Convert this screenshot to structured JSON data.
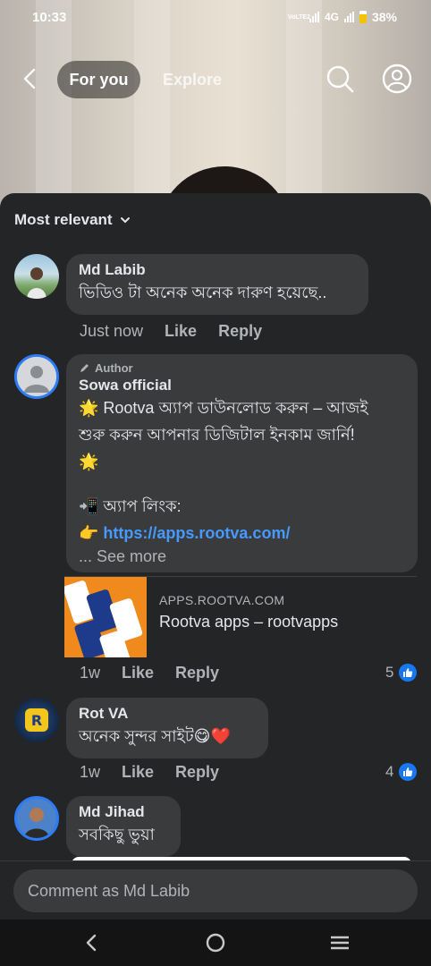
{
  "status": {
    "time": "10:33",
    "network": "4G",
    "battery": "38%",
    "volte": "VoLTE2"
  },
  "topnav": {
    "tab_for_you": "For you",
    "tab_explore": "Explore"
  },
  "sheet": {
    "sort_label": "Most relevant"
  },
  "comments": [
    {
      "name": "Md Labib",
      "lines": [
        "ভিডিও টা অনেক অনেক দারুণ হয়েছে.."
      ],
      "time": "Just now",
      "like": "Like",
      "reply": "Reply"
    },
    {
      "author_tag": "Author",
      "name": "Sowa official",
      "lines": [
        "🌟 Rootva অ্যাপ ডাউনলোড করুন – আজই",
        "শুরু করুন আপনার ডিজিটাল ইনকাম জার্নি!",
        "🌟",
        "",
        "📲 অ্যাপ লিংক:"
      ],
      "link_prefix": "👉 ",
      "link": "https://apps.rootva.com/",
      "see_more": "... See more",
      "preview": {
        "domain": "APPS.ROOTVA.COM",
        "title": "Rootva apps – rootvapps"
      },
      "time": "1w",
      "like": "Like",
      "reply": "Reply",
      "reactions": "5"
    },
    {
      "name": "Rot VA",
      "lines": [
        "অনেক সুন্দর সাইট😋❤️"
      ],
      "time": "1w",
      "like": "Like",
      "reply": "Reply",
      "reactions": "4"
    },
    {
      "name": "Md Jihad",
      "lines": [
        "সবকিছু ভুয়া"
      ]
    }
  ],
  "input": {
    "placeholder": "Comment as Md Labib"
  },
  "colors": {
    "sheet_bg": "#242526",
    "bubble_bg": "#3a3b3c",
    "link": "#4599ff",
    "like_blue": "#1877f2",
    "avatar_ring": "#2d7cf6"
  },
  "icons": [
    "back-arrow-icon",
    "search-icon",
    "profile-icon",
    "chevron-down-icon",
    "pencil-icon",
    "like-icon",
    "nav-back-icon",
    "nav-home-icon",
    "nav-menu-icon"
  ]
}
